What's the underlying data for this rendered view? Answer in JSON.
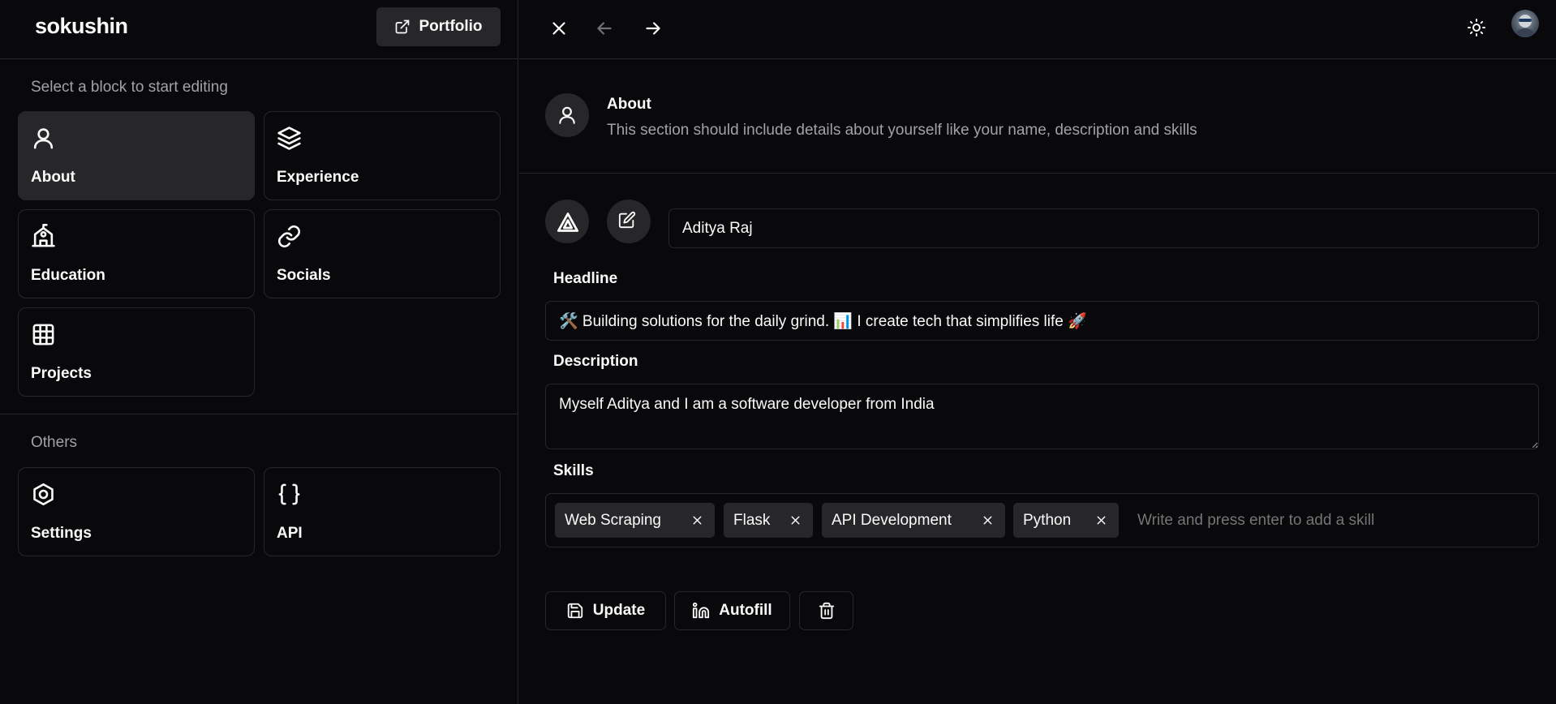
{
  "brand": "sokushin",
  "portfolio_button": "Portfolio",
  "sidebar": {
    "section_label": "Select a block to start editing",
    "blocks": [
      {
        "label": "About",
        "icon": "user-icon",
        "active": true
      },
      {
        "label": "Experience",
        "icon": "layers-icon",
        "active": false
      },
      {
        "label": "Education",
        "icon": "school-icon",
        "active": false
      },
      {
        "label": "Socials",
        "icon": "link-icon",
        "active": false
      },
      {
        "label": "Projects",
        "icon": "grid-icon",
        "active": false
      }
    ],
    "others_label": "Others",
    "others": [
      {
        "label": "Settings",
        "icon": "hexagon-settings-icon"
      },
      {
        "label": "API",
        "icon": "braces-icon"
      }
    ]
  },
  "about": {
    "title": "About",
    "description": "This section should include details about yourself like your name, description and skills"
  },
  "form": {
    "name_value": "Aditya Raj",
    "headline_label": "Headline",
    "headline_value": "🛠️ Building solutions for the daily grind. 📊 I create tech that simplifies life 🚀",
    "description_label": "Description",
    "description_value": "Myself Aditya and I am a software developer from India",
    "skills_label": "Skills",
    "skills": [
      "Web Scraping",
      "Flask",
      "API Development",
      "Python"
    ],
    "skills_placeholder": "Write and press enter to add a skill"
  },
  "actions": {
    "update": "Update",
    "autofill": "Autofill"
  },
  "colors": {
    "background": "#09090b",
    "border": "#27272a",
    "muted_text": "#a1a1aa",
    "accent_surface": "#27272a"
  }
}
